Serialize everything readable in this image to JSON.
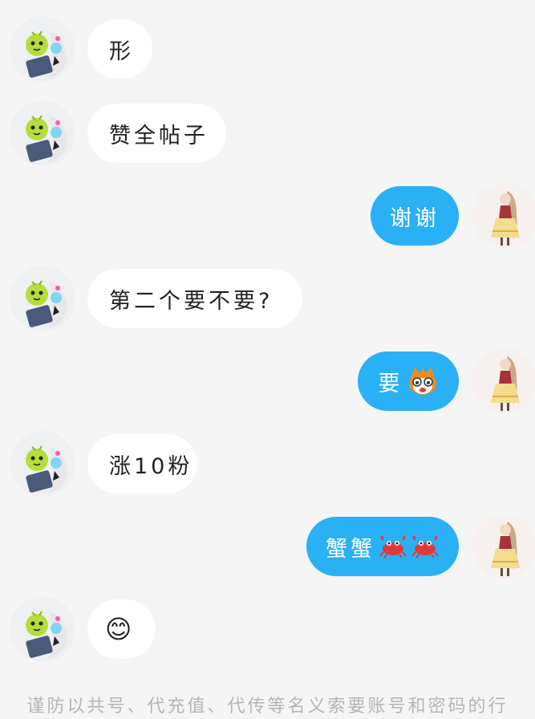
{
  "messages": [
    {
      "side": "left",
      "text": "形"
    },
    {
      "side": "left",
      "text": "赞全帖子"
    },
    {
      "side": "right",
      "text": "谢谢"
    },
    {
      "side": "left",
      "text": "第二个要不要?"
    },
    {
      "side": "right",
      "text": "要",
      "emoji": [
        "cartoon-face-icon"
      ]
    },
    {
      "side": "left",
      "text": "涨10粉"
    },
    {
      "side": "right",
      "text": "蟹蟹",
      "emoji": [
        "crab-icon",
        "crab-icon"
      ]
    },
    {
      "side": "left",
      "text": "😊"
    }
  ],
  "notice": {
    "text": "谨防以共号、代充值、代传等名义索要账号和密码的行"
  },
  "colors": {
    "background": "#f5f5f5",
    "outgoing_bubble": "#29b0f5",
    "incoming_bubble": "#ffffff"
  }
}
